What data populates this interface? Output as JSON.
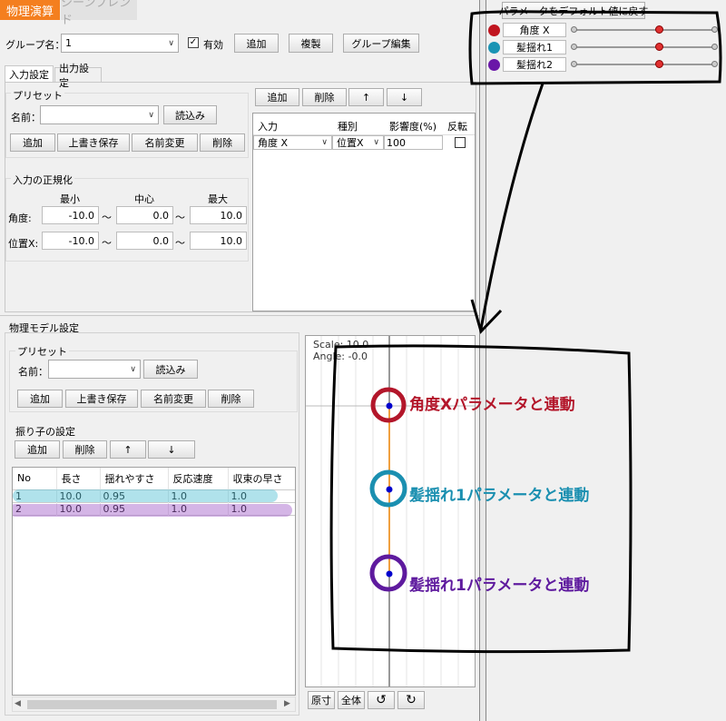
{
  "top_tabs": {
    "physics": "物理演算",
    "scene_blend": "シーンブレンド"
  },
  "group": {
    "label": "グループ名：",
    "value": "1",
    "enabled_label": "有効",
    "enabled": true,
    "add": "追加",
    "duplicate": "複製",
    "edit": "グループ編集"
  },
  "io_tabs": {
    "input": "入力設定",
    "output": "出力設定"
  },
  "input_preset": {
    "title": "プリセット",
    "name_label": "名前：",
    "name_value": "",
    "load": "読込み",
    "add": "追加",
    "overwrite": "上書き保存",
    "rename": "名前変更",
    "delete": "削除"
  },
  "normalization": {
    "title": "入力の正規化",
    "headers": [
      "最小",
      "中心",
      "最大"
    ],
    "rows": [
      {
        "label": "角度:",
        "min": "-10.0",
        "center": "0.0",
        "max": "10.0"
      },
      {
        "label": "位置X:",
        "min": "-10.0",
        "center": "0.0",
        "max": "10.0"
      }
    ],
    "tilde": "～"
  },
  "input_table": {
    "toolbar": {
      "add": "追加",
      "delete": "削除",
      "up": "↑",
      "down": "↓"
    },
    "headers": [
      "入力",
      "種別",
      "影響度(%)",
      "反転"
    ],
    "rows": [
      {
        "input": "角度 X",
        "type": "位置X",
        "weight": "100",
        "reverse": false
      }
    ]
  },
  "model": {
    "title": "物理モデル設定",
    "preset": {
      "title": "プリセット",
      "name_label": "名前：",
      "name_value": "",
      "load": "読込み",
      "add": "追加",
      "overwrite": "上書き保存",
      "rename": "名前変更",
      "delete": "削除"
    },
    "pendulum": {
      "title": "振り子の設定",
      "toolbar": {
        "add": "追加",
        "delete": "削除",
        "up": "↑",
        "down": "↓"
      },
      "headers": [
        "No",
        "長さ",
        "揺れやすさ",
        "反応速度",
        "収束の早さ"
      ],
      "rows": [
        [
          "1",
          "10.0",
          "0.95",
          "1.0",
          "1.0"
        ],
        [
          "2",
          "10.0",
          "0.95",
          "1.0",
          "1.0"
        ]
      ]
    }
  },
  "preview": {
    "scale": "Scale: 10.0",
    "angle": "Angle: -0.0",
    "buttons": {
      "actual": "原寸",
      "all": "全体",
      "rotate_left": "↺",
      "rotate_right": "↻"
    }
  },
  "params": {
    "reset": "パラメータをデフォルト値に戻す",
    "items": [
      {
        "name": "角度 X",
        "color": "#c0151f",
        "value": 0.6
      },
      {
        "name": "髪揺れ1",
        "color": "#1a94b4",
        "value": 0.6
      },
      {
        "name": "髪揺れ2",
        "color": "#6a17a8",
        "value": 0.6
      }
    ]
  },
  "annotations": [
    {
      "text": "角度Xパラメータと連動",
      "color": "#b3162a"
    },
    {
      "text": "髪揺れ1パラメータと連動",
      "color": "#1a8fb0"
    },
    {
      "text": "髪揺れ1パラメータと連動",
      "color": "#5e1a9e"
    }
  ]
}
